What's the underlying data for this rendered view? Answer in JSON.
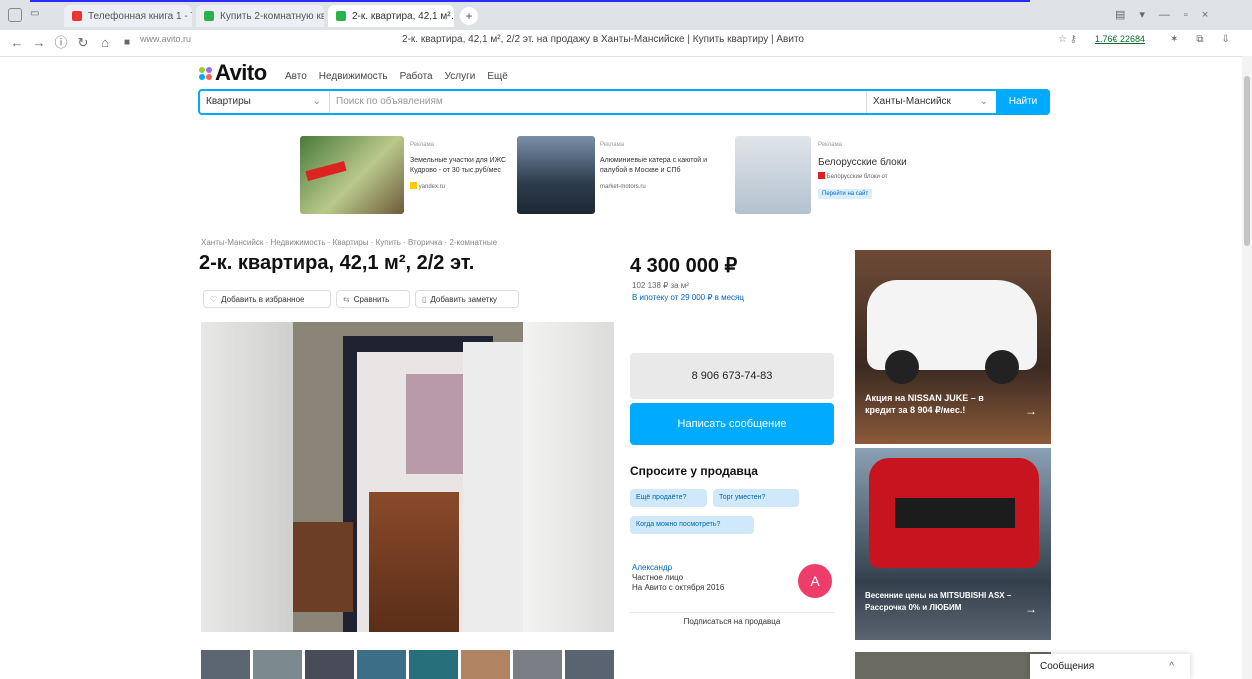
{
  "browser": {
    "tabs": [
      {
        "label": "Телефонная книга 1 - Т…",
        "color": "#e33"
      },
      {
        "label": "Купить 2-комнатную кв…",
        "color": "#2bb24c"
      },
      {
        "label": "2-к. квартира, 42,1 м²…",
        "color": "#2bb24c"
      }
    ],
    "new_tab": "+",
    "url": "www.avito.ru",
    "page_title": "2-к. квартира, 42,1 м², 2/2 эт. на продажу в Ханты-Мансийске | Купить квартиру | Авито",
    "right_controls": "1.76€ 22684"
  },
  "header": {
    "logo": "Avito",
    "nav": [
      "Авто",
      "Недвижимость",
      "Работа",
      "Услуги",
      "Ещё"
    ],
    "search": {
      "category": "Квартиры",
      "placeholder": "Поиск по объявлениям",
      "city": "Ханты-Мансийск",
      "button": "Найти"
    }
  },
  "ads": [
    {
      "label": "Реклама",
      "text": "Земельные участки для ИЖС Кудрово - от 30 тыс.руб/мес",
      "src": "yandex.ru"
    },
    {
      "label": "Реклама",
      "text": "Алюминиевые катера с каютой и палубой в Москве и СПб",
      "src": "market-motors.ru"
    },
    {
      "label": "Реклама",
      "text": "Белорусские блоки",
      "sub": "Белорусские блоки от",
      "button": "Перейти на сайт"
    }
  ],
  "listing": {
    "breadcrumbs": "Ханты-Мансийск · Недвижимость · Квартиры · Купить · Вторичка · 2-комнатные",
    "title": "2-к. квартира, 42,1 м², 2/2 эт.",
    "actions": [
      "Добавить в избранное",
      "Сравнить",
      "Добавить заметку"
    ],
    "price": "4 300 000 ₽",
    "price_per_meter": "102 138 ₽ за м²",
    "mortgage": "В ипотеку от 29 000 ₽ в месяц",
    "phone": "8 906 673-74-83",
    "write_button": "Написать сообщение",
    "ask_title": "Спросите у продавца",
    "ask_chips": [
      "Ещё продаёте?",
      "Торг уместен?",
      "Когда можно посмотреть?"
    ],
    "seller_name": "Александр",
    "seller_type": "Частное лицо",
    "seller_since": "На Авито с октября 2016",
    "avatar_letter": "А",
    "subscribe": "Подписаться на продавца"
  },
  "banners": [
    {
      "text": "Акция на NISSAN JUKE – в кредит за 8 904 ₽/мес.!"
    },
    {
      "text": "Весенние цены на MITSUBISHI ASX – Рассрочка 0% и ЛЮБИМ"
    }
  ],
  "messages_bar": {
    "label": "Сообщения",
    "chevron": "^"
  }
}
